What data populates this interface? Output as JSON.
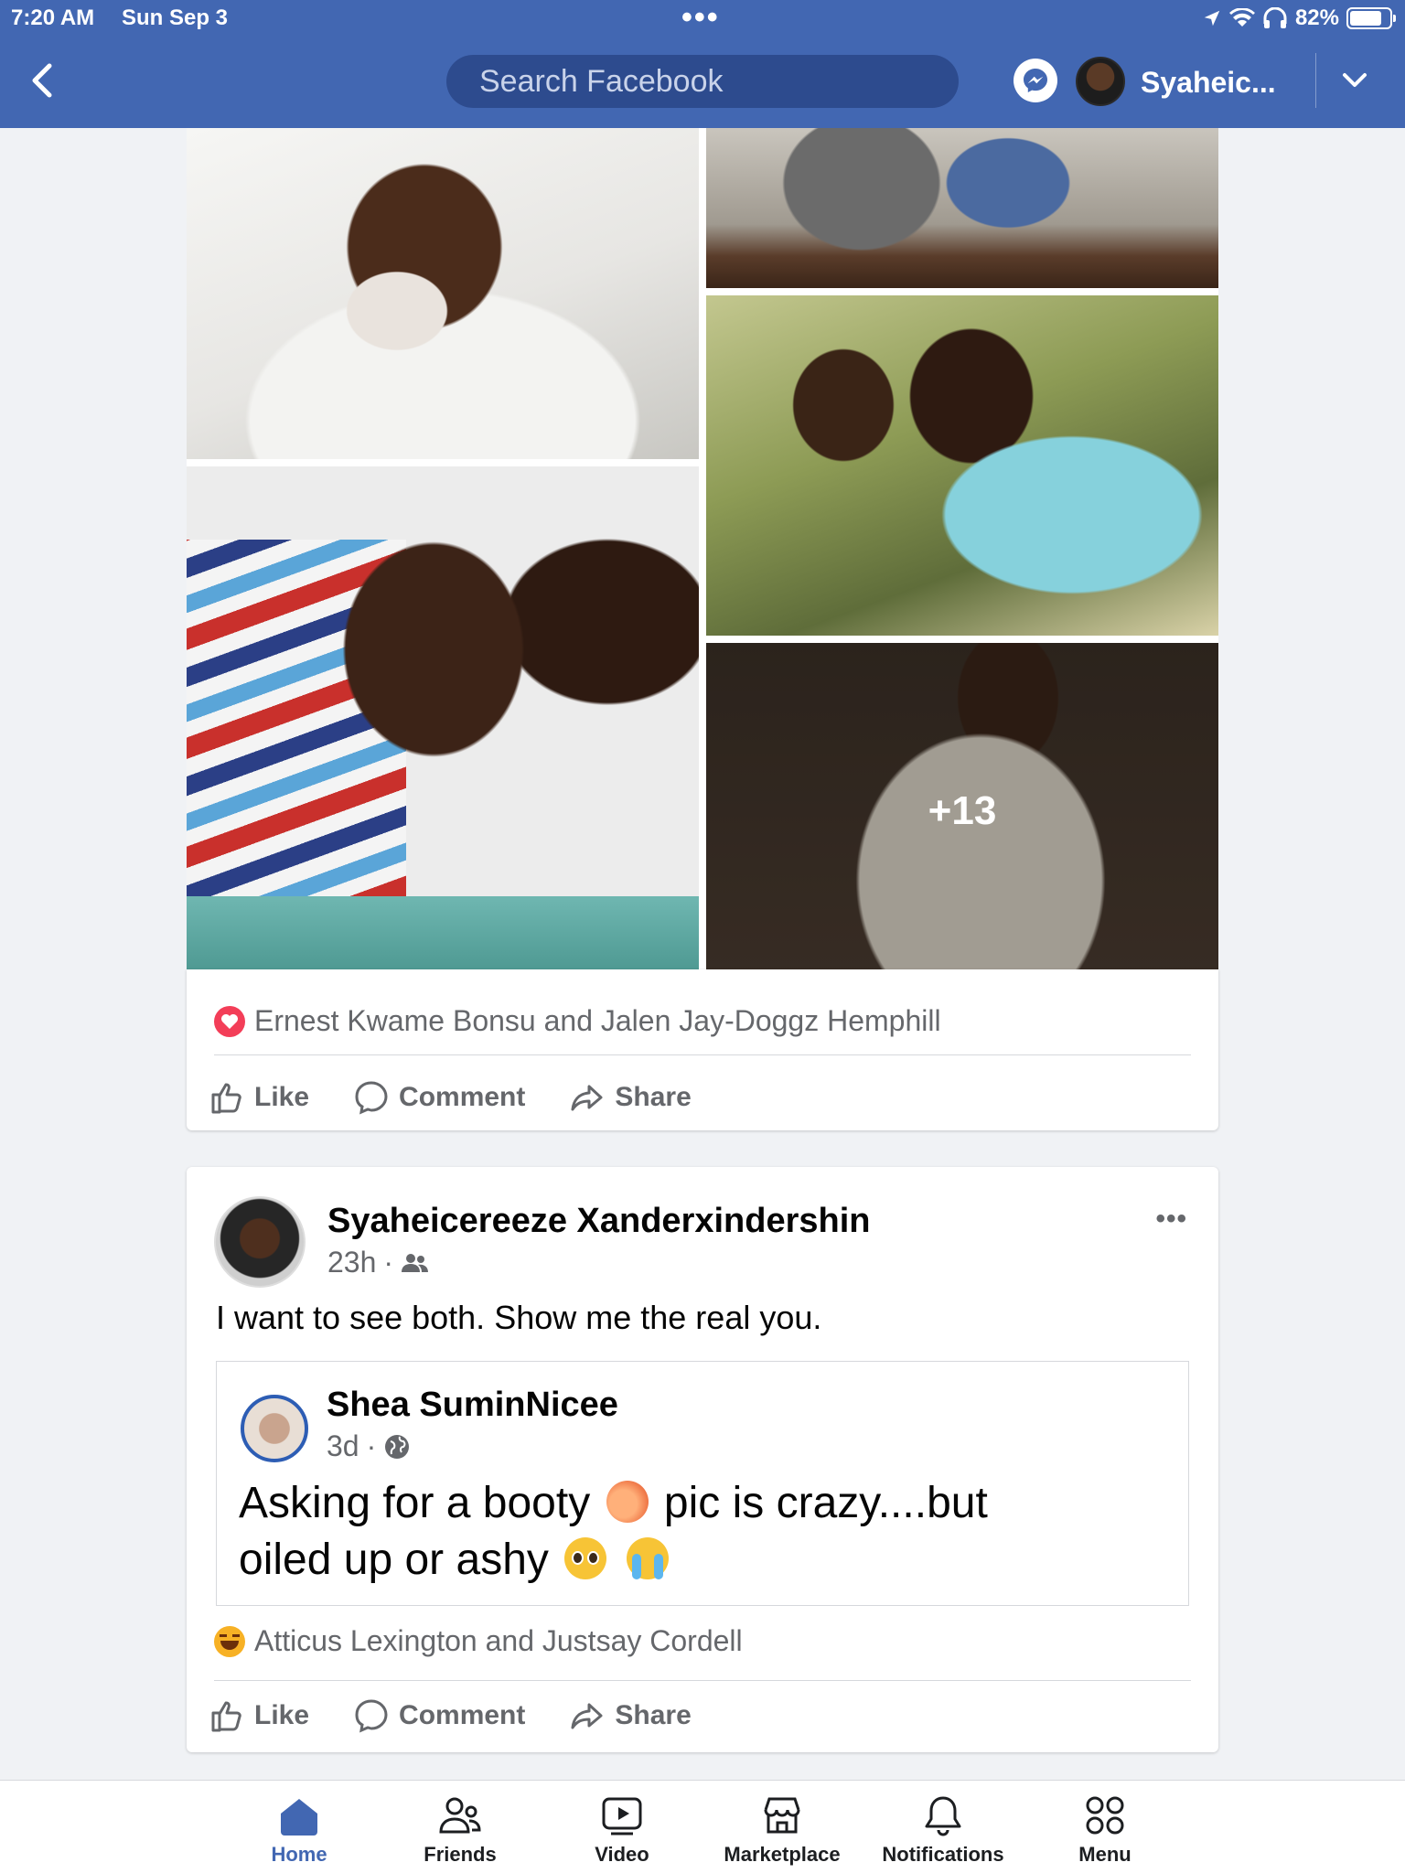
{
  "status_bar": {
    "time": "7:20 AM",
    "date": "Sun Sep 3",
    "battery": "82%",
    "battery_level": 0.82
  },
  "header": {
    "search_placeholder": "Search Facebook",
    "profile_name": "Syaheic..."
  },
  "post1": {
    "more_photos": "+13",
    "reactions_text": "Ernest Kwame Bonsu and Jalen Jay-Doggz Hemphill",
    "reaction_icon": "love-icon"
  },
  "actions": {
    "like": "Like",
    "comment": "Comment",
    "share": "Share"
  },
  "post2": {
    "author": "Syaheicereeze Xanderxindershin",
    "time": "23h",
    "audience_icon": "friends-icon",
    "text": "I want to see both. Show me the real you.",
    "shared": {
      "author": "Shea SuminNicee",
      "time": "3d",
      "audience_icon": "globe-icon",
      "text_part1": "Asking for a booty",
      "text_part2": "pic is crazy....but",
      "text_part3": "oiled up or ashy"
    },
    "reactions_text": "Atticus Lexington and Justsay Cordell",
    "reaction_icon": "haha-icon"
  },
  "bottom_nav": [
    {
      "label": "Home"
    },
    {
      "label": "Friends"
    },
    {
      "label": "Video"
    },
    {
      "label": "Marketplace"
    },
    {
      "label": "Notifications"
    },
    {
      "label": "Menu"
    }
  ],
  "colors": {
    "brand": "#4267b2",
    "text_secondary": "#65676b",
    "love": "#f33e58",
    "haha": "#f7b125"
  }
}
